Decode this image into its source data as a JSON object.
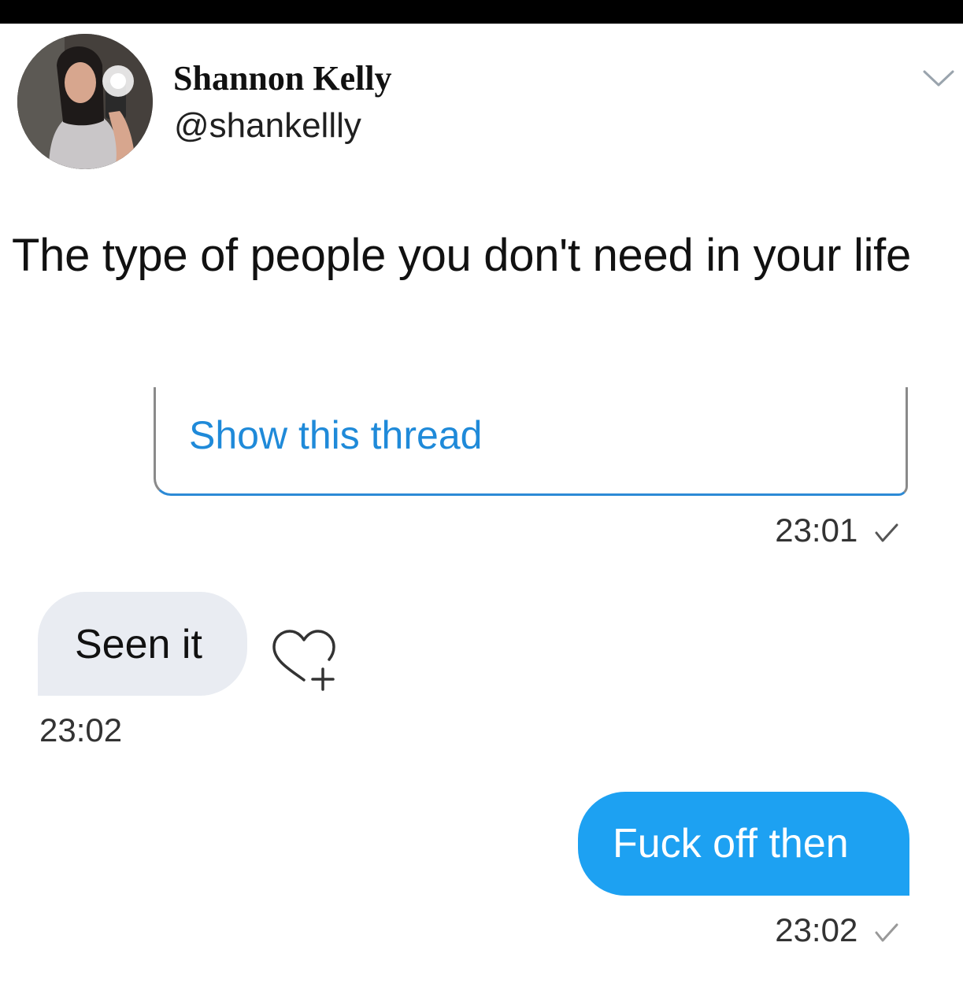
{
  "tweet": {
    "author_name": "Shannon Kelly",
    "author_handle": "@shankellly",
    "text": "The type of people you don't need in your life",
    "show_thread_label": "Show this thread",
    "avatar_icon": "profile-photo",
    "menu_icon": "chevron-down-icon"
  },
  "messages": [
    {
      "direction": "outgoing",
      "kind": "shared-tweet",
      "time": "23:01",
      "status_icon": "check-icon"
    },
    {
      "direction": "incoming",
      "text": "Seen it",
      "time": "23:02",
      "reaction_icon": "add-reaction-heart-icon"
    },
    {
      "direction": "outgoing",
      "text": "Fuck off then",
      "time": "23:02",
      "status_icon": "check-icon"
    }
  ],
  "colors": {
    "accent_blue": "#1da1f2",
    "link_blue": "#1f8ad9",
    "incoming_bubble": "#e9ecf2",
    "top_bar": "#000000"
  }
}
